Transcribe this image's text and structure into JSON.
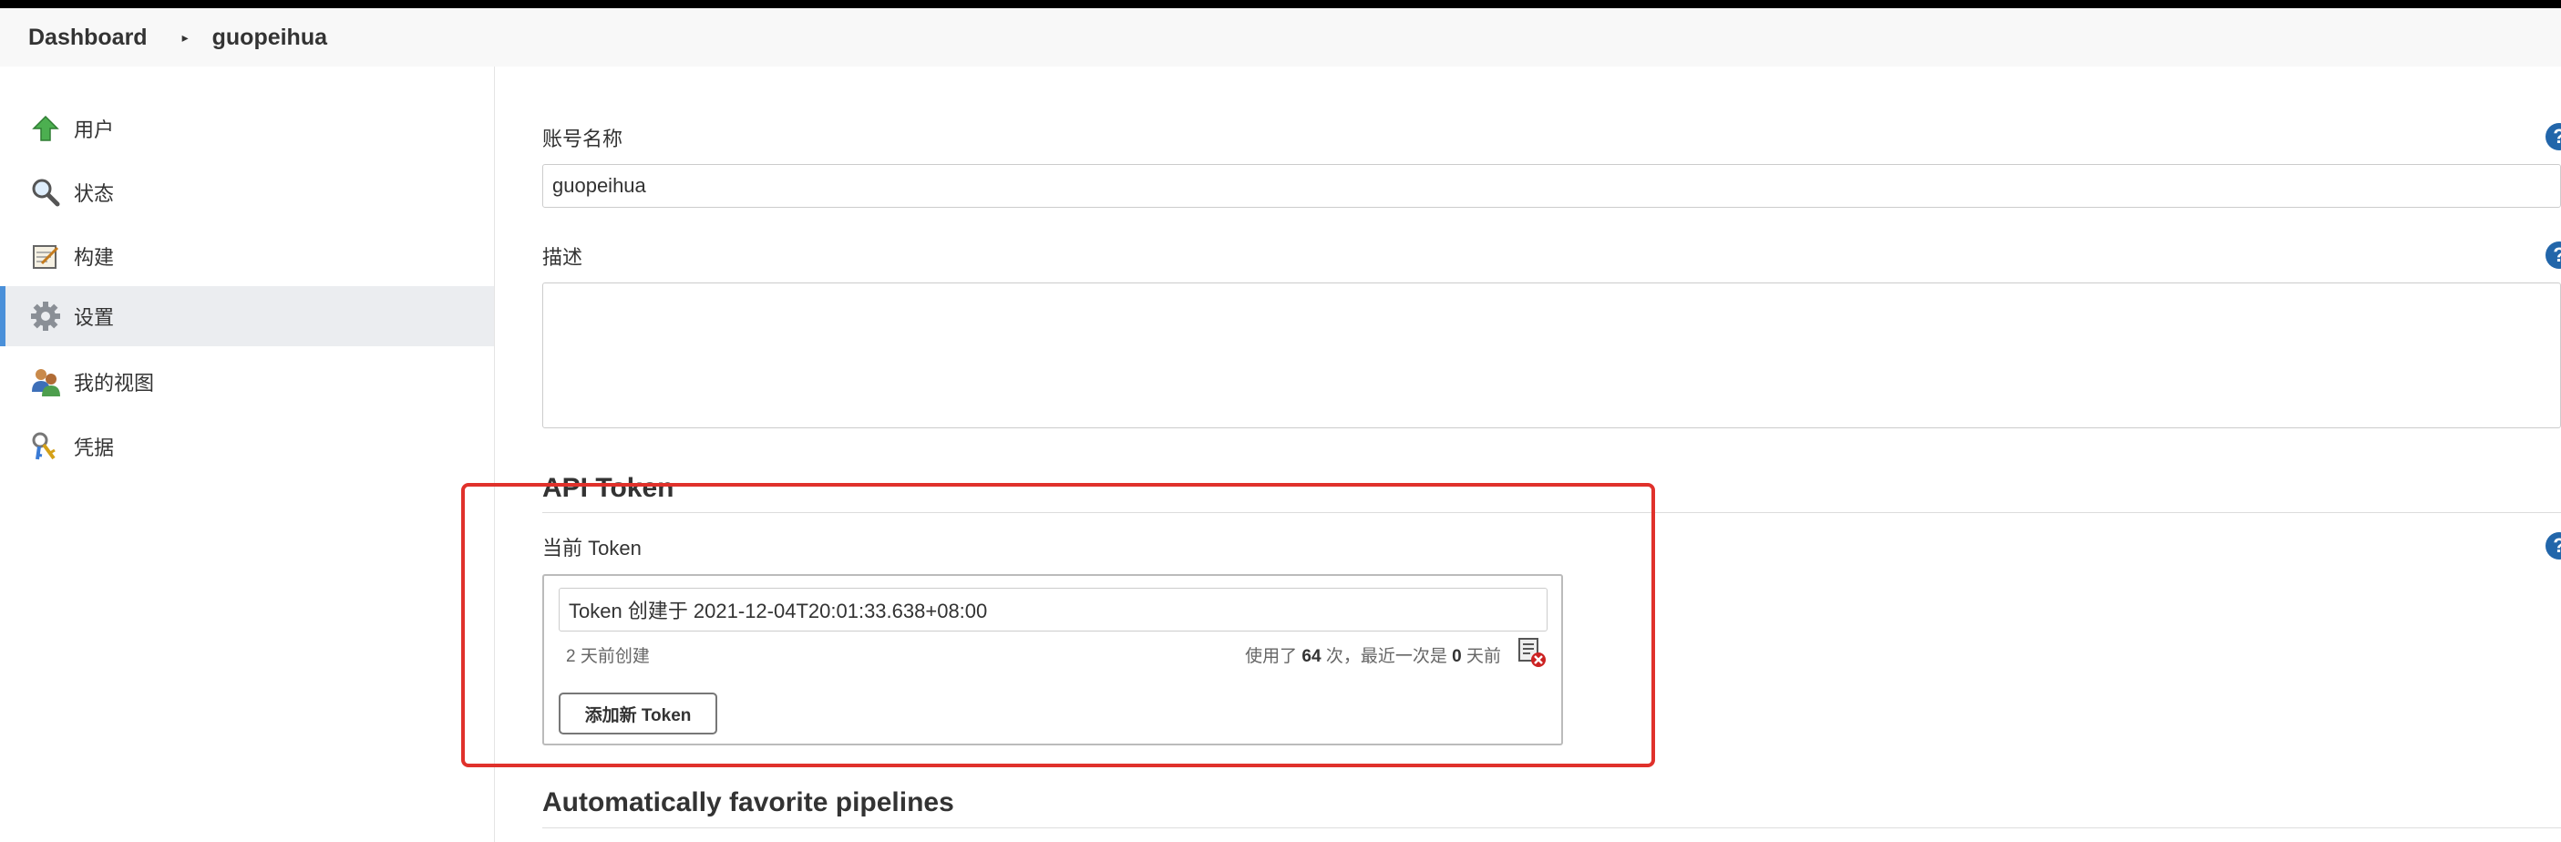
{
  "breadcrumb": {
    "home": "Dashboard",
    "separator": "▸",
    "user": "guopeihua"
  },
  "sidebar": {
    "items": [
      {
        "label": "用户",
        "icon": "up-arrow-icon",
        "active": false
      },
      {
        "label": "状态",
        "icon": "magnifier-icon",
        "active": false
      },
      {
        "label": "构建",
        "icon": "notepad-icon",
        "active": false
      },
      {
        "label": "设置",
        "icon": "gear-icon",
        "active": true
      },
      {
        "label": "我的视图",
        "icon": "people-icon",
        "active": false
      },
      {
        "label": "凭据",
        "icon": "keys-icon",
        "active": false
      }
    ]
  },
  "form": {
    "full_name_label": "账号名称",
    "full_name_value": "guopeihua",
    "description_label": "描述",
    "description_value": "",
    "help_glyph": "?"
  },
  "api_token": {
    "section_title": "API Token",
    "current_label": "当前 Token",
    "token_name": "Token 创建于 2021-12-04T20:01:33.638+08:00",
    "created_ago": "2 天前创建",
    "usage_prefix": "使用了",
    "usage_count": "64",
    "usage_mid": "次，最近一次是",
    "last_used_days": "0",
    "usage_suffix": "天前",
    "add_button": "添加新 Token"
  },
  "next_section": {
    "title": "Automatically favorite pipelines"
  },
  "colors": {
    "highlight": "#e0312b",
    "help": "#2266aa",
    "active_border": "#4a90d9"
  }
}
